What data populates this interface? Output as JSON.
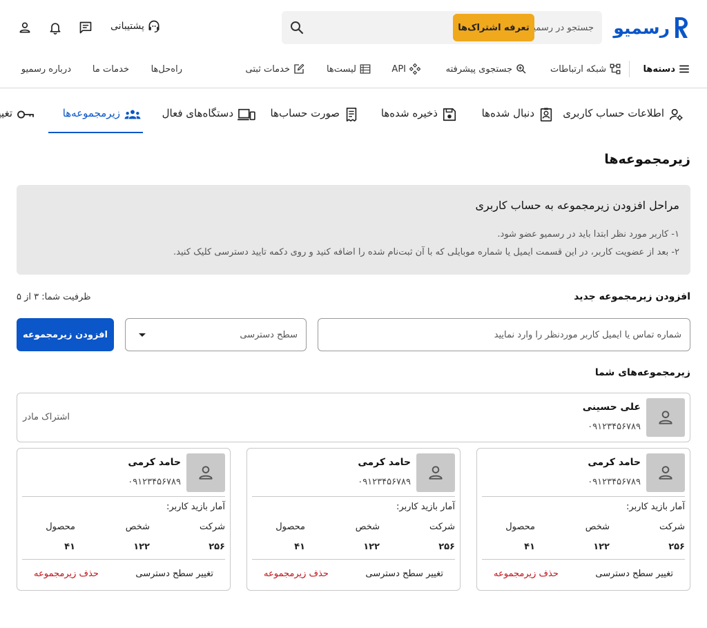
{
  "header": {
    "logo_text": "رسمیو",
    "search_placeholder": "جستجو در رسمیو...",
    "plans_label": "تعرفه اشتراک‌ها",
    "support_label": "پشتیبانی",
    "icons": [
      "search-icon",
      "headset-icon",
      "messages-icon",
      "bell-icon",
      "user-icon",
      "logo-mark-icon"
    ]
  },
  "nav": {
    "categories_label": "دسته‌ها",
    "items": [
      {
        "label": "شبکه ارتباطات",
        "icon": "network-icon"
      },
      {
        "label": "جستجوی پیشرفته",
        "icon": "advanced-search-icon"
      },
      {
        "label": "API",
        "icon": "api-icon"
      },
      {
        "label": "لیست‌ها",
        "icon": "list-icon"
      },
      {
        "label": "خدمات ثبتی",
        "icon": "edit-icon"
      },
      {
        "label": "راه‌حل‌ها"
      },
      {
        "label": "خدمات ما"
      },
      {
        "label": "درباره رسمیو"
      }
    ]
  },
  "tabs": [
    {
      "label": "اطلاعات حساب کاربری",
      "icon": "user-settings-icon"
    },
    {
      "label": "دنبال شده‌ها",
      "icon": "followed-icon"
    },
    {
      "label": "ذخیره شده‌ها",
      "icon": "save-icon"
    },
    {
      "label": "صورت حساب‌ها",
      "icon": "receipt-icon"
    },
    {
      "label": "دستگاه‌های فعال",
      "icon": "devices-icon"
    },
    {
      "label": "زیرمجموعه‌ها",
      "icon": "group-icon",
      "active": true
    },
    {
      "label": "تغییر",
      "icon": "key-icon"
    }
  ],
  "page_title": "زیرمجموعه‌ها",
  "info": {
    "title": "مراحل افزودن زیرمجموعه به حساب کاربری",
    "steps": [
      "۱- کاربر مورد نظر ابتدا باید در رسمیو عضو شود.",
      "۲- بعد از عضویت کاربر، در این قسمت ایمیل یا شماره موبایلی که با آن ثبت‌نام شده را اضافه کنید و روی دکمه تایید دسترسی کلیک کنید."
    ]
  },
  "add": {
    "title": "افزودن زیرمجموعه جدید",
    "capacity": "ظرفیت شما: ۳ از ۵",
    "contact_placeholder": "شماره تماس یا ایمیل کاربر موردنظر را وارد نمایید",
    "access_placeholder": "سطح دسترسی",
    "button_label": "افزودن زیرمجموعه"
  },
  "yours_title": "زیرمجموعه‌های شما",
  "parent": {
    "name": "علی حسینی",
    "phone": "۰۹۱۲۳۴۵۶۷۸۹",
    "label": "اشتراک مادر"
  },
  "subs": [
    {
      "name": "حامد کرمی",
      "phone": "۰۹۱۲۳۴۵۶۷۸۹",
      "stats_label": "آمار بازید کاربر:",
      "stat_headers": [
        "شرکت",
        "شخص",
        "محصول"
      ],
      "stat_values": [
        "۲۵۶",
        "۱۲۲",
        "۴۱"
      ],
      "change_access": "تغییر سطح دسترسی",
      "remove": "حذف زیرمجموعه"
    },
    {
      "name": "حامد کرمی",
      "phone": "۰۹۱۲۳۴۵۶۷۸۹",
      "stats_label": "آمار بازید کاربر:",
      "stat_headers": [
        "شرکت",
        "شخص",
        "محصول"
      ],
      "stat_values": [
        "۲۵۶",
        "۱۲۲",
        "۴۱"
      ],
      "change_access": "تغییر سطح دسترسی",
      "remove": "حذف زیرمجموعه"
    },
    {
      "name": "حامد کرمی",
      "phone": "۰۹۱۲۳۴۵۶۷۸۹",
      "stats_label": "آمار بازید کاربر:",
      "stat_headers": [
        "شرکت",
        "شخص",
        "محصول"
      ],
      "stat_values": [
        "۲۵۶",
        "۱۲۲",
        "۴۱"
      ],
      "change_access": "تغییر سطح دسترسی",
      "remove": "حذف زیرمجموعه"
    }
  ],
  "colors": {
    "brand": "#0b56c8",
    "plans": "#f0a81d",
    "danger": "#c0141b",
    "info_bg": "#e8e8e8",
    "avatar_bg": "#c9c9c9"
  }
}
